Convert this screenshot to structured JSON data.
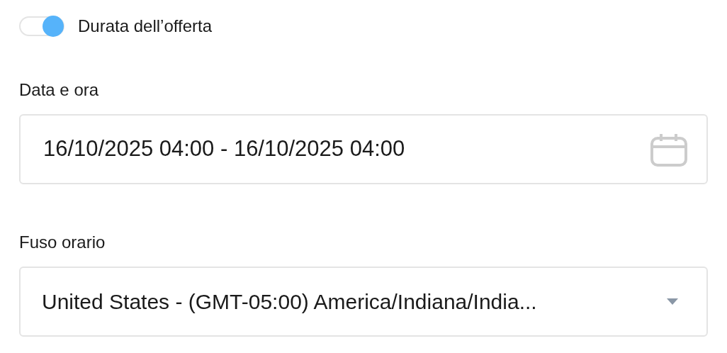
{
  "toggle": {
    "label": "Durata dell’offerta",
    "on": true
  },
  "date_field": {
    "label": "Data e ora",
    "value": "16/10/2025 04:00 - 16/10/2025 04:00"
  },
  "timezone_select": {
    "label": "Fuso orario",
    "value": "United States - (GMT-05:00) America/Indiana/India..."
  }
}
